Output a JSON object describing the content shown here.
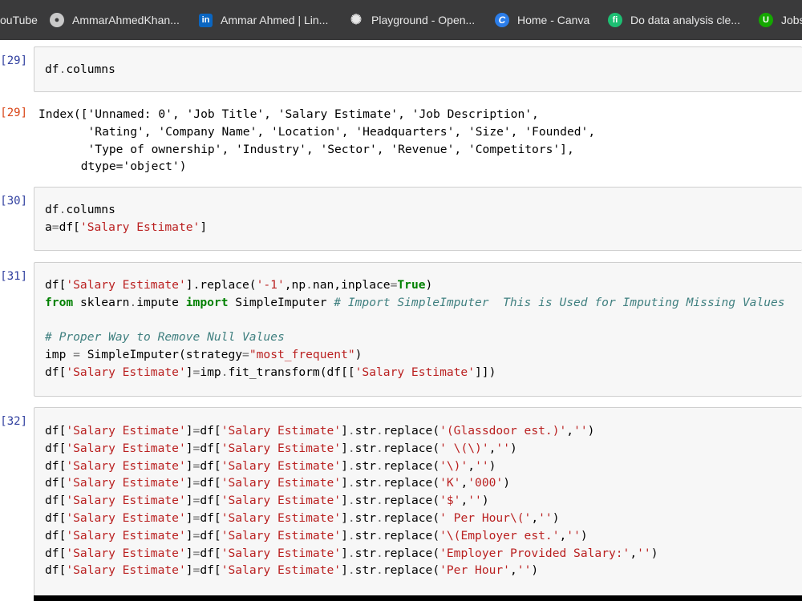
{
  "bookmarks": [
    {
      "label": "ouTube",
      "icon": "youtube-icon",
      "color": "#ff0000"
    },
    {
      "label": "AmmarAhmedKhan...",
      "icon": "github-icon",
      "color": "#c9c9c9"
    },
    {
      "label": "Ammar Ahmed | Lin...",
      "icon": "linkedin-icon",
      "color": "#0a66c2"
    },
    {
      "label": "Playground - Open...",
      "icon": "openai-icon",
      "color": "#e8e8e8"
    },
    {
      "label": "Home - Canva",
      "icon": "canva-icon",
      "color": "#00c4cc"
    },
    {
      "label": "Do data analysis cle...",
      "icon": "fiverr-icon",
      "color": "#1dbf73"
    },
    {
      "label": "Jobs",
      "icon": "upwork-icon",
      "color": "#14a800"
    }
  ],
  "cells": {
    "c29_in": {
      "prompt": "[29]:"
    },
    "c29_out": {
      "prompt": "[29]:"
    },
    "c30_in": {
      "prompt": "[30]:"
    },
    "c31_in": {
      "prompt": "[31]:"
    },
    "c32_in": {
      "prompt": "[32]:"
    }
  },
  "code": {
    "c29": [
      "df",
      ".",
      "columns"
    ],
    "c29_out": [
      "Index(['Unnamed: 0', 'Job Title', 'Salary Estimate', 'Job Description',",
      "       'Rating', 'Company Name', 'Location', 'Headquarters', 'Size', 'Founded',",
      "       'Type of ownership', 'Industry', 'Sector', 'Revenue', 'Competitors'],",
      "      dtype='object')"
    ],
    "c30": {
      "l1": [
        "df",
        ".",
        "columns"
      ],
      "l2": [
        "a",
        "=",
        "df[",
        "'Salary Estimate'",
        "]"
      ]
    },
    "c31": {
      "l1": [
        "df[",
        "'Salary Estimate'",
        "].replace(",
        "'-1'",
        ",np",
        ".",
        "nan,inplace",
        "=",
        "True",
        ")"
      ],
      "l2": [
        "from",
        " sklearn",
        ".",
        "impute ",
        "import",
        " SimpleImputer ",
        "# Import SimpleImputer  This is Used for Imputing Missing Values"
      ],
      "l4": [
        "# Proper Way to Remove Null Values"
      ],
      "l5": [
        "imp ",
        "=",
        " SimpleImputer(strategy",
        "=",
        "\"most_frequent\"",
        ")"
      ],
      "l6": [
        "df[",
        "'Salary Estimate'",
        "]",
        "=",
        "imp",
        ".",
        "fit_transform(df[[",
        "'Salary Estimate'",
        "]])"
      ]
    },
    "c32": {
      "prefix": [
        "df[",
        "'Salary Estimate'",
        "]",
        "=",
        "df[",
        "'Salary Estimate'",
        "]",
        ".",
        "str",
        ".",
        "replace("
      ],
      "args": [
        [
          "'(Glassdoor est.)'",
          ",",
          "''",
          ")"
        ],
        [
          "' \\(\\)'",
          ",",
          "''",
          ")"
        ],
        [
          "'\\)'",
          ",",
          "''",
          ")"
        ],
        [
          "'K'",
          ",",
          "'000'",
          ")"
        ],
        [
          "'$'",
          ",",
          "''",
          ")"
        ],
        [
          "' Per Hour\\('",
          ",",
          "''",
          ")"
        ],
        [
          "'\\(Employer est.'",
          ",",
          "''",
          ")"
        ],
        [
          "'Employer Provided Salary:'",
          ",",
          "''",
          ")"
        ],
        [
          "'Per Hour'",
          ",",
          "''",
          ")"
        ]
      ]
    }
  }
}
